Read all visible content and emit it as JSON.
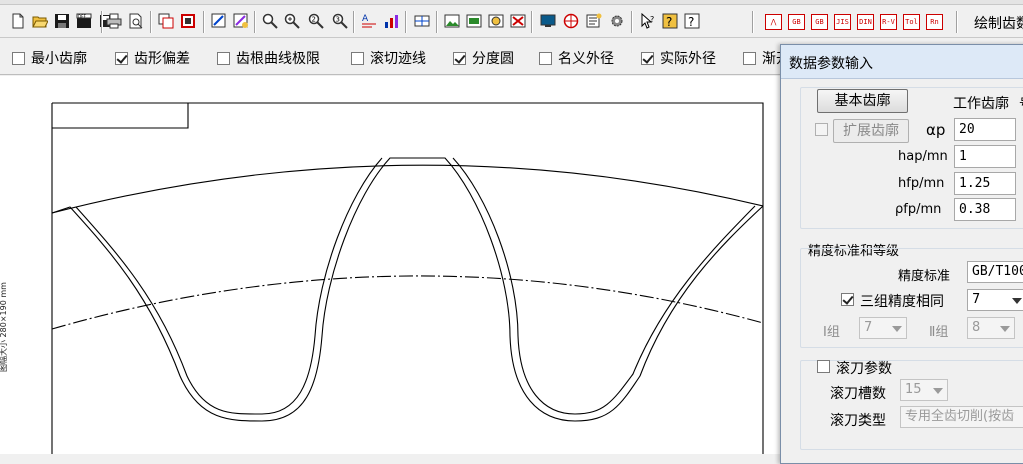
{
  "toolbar1": {
    "icons": [
      "new-file-icon",
      "open-folder-icon",
      "save-icon",
      "save-as-icon",
      "save-disk-icon",
      "print-icon",
      "print-preview-icon",
      "copy-view-icon",
      "frame-icon",
      "redraw-icon",
      "redraw-colored-icon",
      "zoom-window-icon",
      "zoom-in-icon",
      "zoom-2-icon",
      "zoom-3-icon",
      "text-settings-icon",
      "chart-settings-icon",
      "grid-icon",
      "image-1-icon",
      "image-2-icon",
      "image-3-icon",
      "image-4-icon",
      "monitor-icon",
      "palette-icon",
      "properties-icon",
      "gear-icon",
      "help-pointer-icon",
      "help-question-icon",
      "help-book-icon"
    ],
    "standard_buttons": [
      "⋀",
      "GB 10095",
      "GB 2363",
      "JIS",
      "DIN",
      "R-V",
      "Tol",
      "Rn"
    ],
    "draw_button": "绘制齿数"
  },
  "options": [
    {
      "label": "最小齿廓",
      "checked": false
    },
    {
      "label": "齿形偏差",
      "checked": true
    },
    {
      "label": "齿根曲线极限",
      "checked": false
    },
    {
      "label": "滚切迹线",
      "checked": false
    },
    {
      "label": "分度圆",
      "checked": true
    },
    {
      "label": "名义外径",
      "checked": false
    },
    {
      "label": "实际外径",
      "checked": true
    },
    {
      "label": "渐开",
      "checked": false
    }
  ],
  "canvas": {
    "paper_label": "图幅大小  280×190 mm"
  },
  "dialog": {
    "title": "数据参数输入",
    "basic_profile_button": "基本齿廓",
    "working_profile_label": "工作齿廓",
    "working_profile_suffix": "号",
    "extend_profile_label": "扩展齿廓",
    "extend_profile_checked": false,
    "params": [
      {
        "label": "αp",
        "value": "20"
      },
      {
        "label": "hap/mn",
        "value": "1"
      },
      {
        "label": "hfp/mn",
        "value": "1.25"
      },
      {
        "label": "ρfp/mn",
        "value": "0.38"
      }
    ],
    "precision_group": "精度标准和等级",
    "precision_standard_label": "精度标准",
    "precision_standard_value": "GB/T100",
    "three_groups_label": "三组精度相同",
    "three_groups_checked": true,
    "three_groups_value": "7",
    "group1_label": "Ⅰ组",
    "group1_value": "7",
    "group2_label": "Ⅱ组",
    "group2_value": "8",
    "hob_params_label": "滚刀参数",
    "hob_params_checked": false,
    "hob_slots_label": "滚刀槽数",
    "hob_slots_value": "15",
    "hob_type_label": "滚刀类型",
    "hob_type_value": "专用全齿切削(按齿"
  }
}
